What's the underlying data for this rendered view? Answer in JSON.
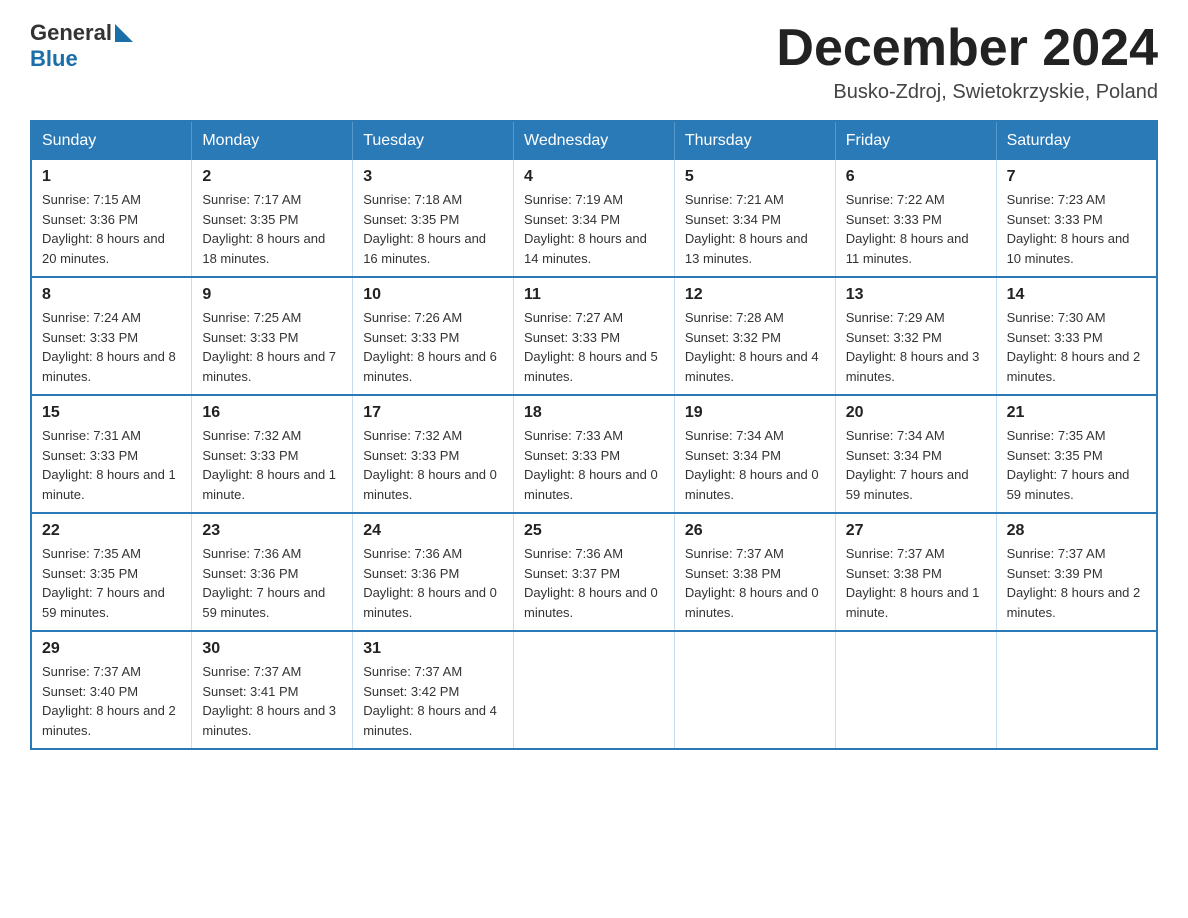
{
  "header": {
    "logo_general": "General",
    "logo_blue": "Blue",
    "month_title": "December 2024",
    "location": "Busko-Zdroj, Swietokrzyskie, Poland"
  },
  "weekdays": [
    "Sunday",
    "Monday",
    "Tuesday",
    "Wednesday",
    "Thursday",
    "Friday",
    "Saturday"
  ],
  "weeks": [
    [
      {
        "day": "1",
        "sunrise": "Sunrise: 7:15 AM",
        "sunset": "Sunset: 3:36 PM",
        "daylight": "Daylight: 8 hours and 20 minutes."
      },
      {
        "day": "2",
        "sunrise": "Sunrise: 7:17 AM",
        "sunset": "Sunset: 3:35 PM",
        "daylight": "Daylight: 8 hours and 18 minutes."
      },
      {
        "day": "3",
        "sunrise": "Sunrise: 7:18 AM",
        "sunset": "Sunset: 3:35 PM",
        "daylight": "Daylight: 8 hours and 16 minutes."
      },
      {
        "day": "4",
        "sunrise": "Sunrise: 7:19 AM",
        "sunset": "Sunset: 3:34 PM",
        "daylight": "Daylight: 8 hours and 14 minutes."
      },
      {
        "day": "5",
        "sunrise": "Sunrise: 7:21 AM",
        "sunset": "Sunset: 3:34 PM",
        "daylight": "Daylight: 8 hours and 13 minutes."
      },
      {
        "day": "6",
        "sunrise": "Sunrise: 7:22 AM",
        "sunset": "Sunset: 3:33 PM",
        "daylight": "Daylight: 8 hours and 11 minutes."
      },
      {
        "day": "7",
        "sunrise": "Sunrise: 7:23 AM",
        "sunset": "Sunset: 3:33 PM",
        "daylight": "Daylight: 8 hours and 10 minutes."
      }
    ],
    [
      {
        "day": "8",
        "sunrise": "Sunrise: 7:24 AM",
        "sunset": "Sunset: 3:33 PM",
        "daylight": "Daylight: 8 hours and 8 minutes."
      },
      {
        "day": "9",
        "sunrise": "Sunrise: 7:25 AM",
        "sunset": "Sunset: 3:33 PM",
        "daylight": "Daylight: 8 hours and 7 minutes."
      },
      {
        "day": "10",
        "sunrise": "Sunrise: 7:26 AM",
        "sunset": "Sunset: 3:33 PM",
        "daylight": "Daylight: 8 hours and 6 minutes."
      },
      {
        "day": "11",
        "sunrise": "Sunrise: 7:27 AM",
        "sunset": "Sunset: 3:33 PM",
        "daylight": "Daylight: 8 hours and 5 minutes."
      },
      {
        "day": "12",
        "sunrise": "Sunrise: 7:28 AM",
        "sunset": "Sunset: 3:32 PM",
        "daylight": "Daylight: 8 hours and 4 minutes."
      },
      {
        "day": "13",
        "sunrise": "Sunrise: 7:29 AM",
        "sunset": "Sunset: 3:32 PM",
        "daylight": "Daylight: 8 hours and 3 minutes."
      },
      {
        "day": "14",
        "sunrise": "Sunrise: 7:30 AM",
        "sunset": "Sunset: 3:33 PM",
        "daylight": "Daylight: 8 hours and 2 minutes."
      }
    ],
    [
      {
        "day": "15",
        "sunrise": "Sunrise: 7:31 AM",
        "sunset": "Sunset: 3:33 PM",
        "daylight": "Daylight: 8 hours and 1 minute."
      },
      {
        "day": "16",
        "sunrise": "Sunrise: 7:32 AM",
        "sunset": "Sunset: 3:33 PM",
        "daylight": "Daylight: 8 hours and 1 minute."
      },
      {
        "day": "17",
        "sunrise": "Sunrise: 7:32 AM",
        "sunset": "Sunset: 3:33 PM",
        "daylight": "Daylight: 8 hours and 0 minutes."
      },
      {
        "day": "18",
        "sunrise": "Sunrise: 7:33 AM",
        "sunset": "Sunset: 3:33 PM",
        "daylight": "Daylight: 8 hours and 0 minutes."
      },
      {
        "day": "19",
        "sunrise": "Sunrise: 7:34 AM",
        "sunset": "Sunset: 3:34 PM",
        "daylight": "Daylight: 8 hours and 0 minutes."
      },
      {
        "day": "20",
        "sunrise": "Sunrise: 7:34 AM",
        "sunset": "Sunset: 3:34 PM",
        "daylight": "Daylight: 7 hours and 59 minutes."
      },
      {
        "day": "21",
        "sunrise": "Sunrise: 7:35 AM",
        "sunset": "Sunset: 3:35 PM",
        "daylight": "Daylight: 7 hours and 59 minutes."
      }
    ],
    [
      {
        "day": "22",
        "sunrise": "Sunrise: 7:35 AM",
        "sunset": "Sunset: 3:35 PM",
        "daylight": "Daylight: 7 hours and 59 minutes."
      },
      {
        "day": "23",
        "sunrise": "Sunrise: 7:36 AM",
        "sunset": "Sunset: 3:36 PM",
        "daylight": "Daylight: 7 hours and 59 minutes."
      },
      {
        "day": "24",
        "sunrise": "Sunrise: 7:36 AM",
        "sunset": "Sunset: 3:36 PM",
        "daylight": "Daylight: 8 hours and 0 minutes."
      },
      {
        "day": "25",
        "sunrise": "Sunrise: 7:36 AM",
        "sunset": "Sunset: 3:37 PM",
        "daylight": "Daylight: 8 hours and 0 minutes."
      },
      {
        "day": "26",
        "sunrise": "Sunrise: 7:37 AM",
        "sunset": "Sunset: 3:38 PM",
        "daylight": "Daylight: 8 hours and 0 minutes."
      },
      {
        "day": "27",
        "sunrise": "Sunrise: 7:37 AM",
        "sunset": "Sunset: 3:38 PM",
        "daylight": "Daylight: 8 hours and 1 minute."
      },
      {
        "day": "28",
        "sunrise": "Sunrise: 7:37 AM",
        "sunset": "Sunset: 3:39 PM",
        "daylight": "Daylight: 8 hours and 2 minutes."
      }
    ],
    [
      {
        "day": "29",
        "sunrise": "Sunrise: 7:37 AM",
        "sunset": "Sunset: 3:40 PM",
        "daylight": "Daylight: 8 hours and 2 minutes."
      },
      {
        "day": "30",
        "sunrise": "Sunrise: 7:37 AM",
        "sunset": "Sunset: 3:41 PM",
        "daylight": "Daylight: 8 hours and 3 minutes."
      },
      {
        "day": "31",
        "sunrise": "Sunrise: 7:37 AM",
        "sunset": "Sunset: 3:42 PM",
        "daylight": "Daylight: 8 hours and 4 minutes."
      },
      null,
      null,
      null,
      null
    ]
  ]
}
